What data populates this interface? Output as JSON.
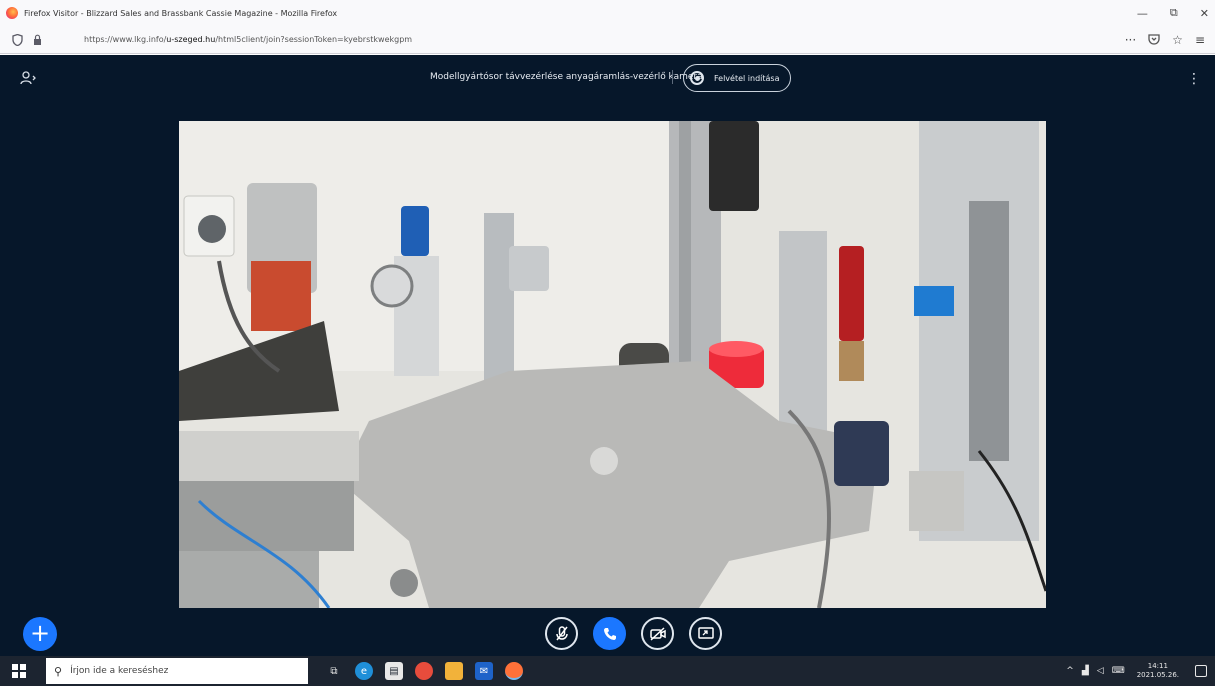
{
  "browser": {
    "tab_title": "Firefox Visitor - Blizzard Sales and Brassbank Cassie Magazine - Mozilla Firefox",
    "url_prefix": "https://www.lkg.info/",
    "url_domain": "u-szeged.hu",
    "url_path": "/html5client/join?sessionToken=kyebrstkwekgpm",
    "window_controls": {
      "minimize": "—",
      "maximize": "⧉",
      "close": "✕"
    },
    "toolbar_icons": [
      "more-icon",
      "pocket-icon",
      "bookmark-star-icon",
      "menu-icon"
    ]
  },
  "meeting": {
    "title": "Modellgyártósor távvezérlése anyagáramlás-vezérlő kamera",
    "recording_label": "Felvétel indítása",
    "video_alt": "Live camera feed of an automated pneumatic production-line module",
    "controls": [
      {
        "name": "mute-button",
        "icon": "microphone-off-icon",
        "glyph": "🎤",
        "active": false
      },
      {
        "name": "leave-audio-button",
        "icon": "phone-icon",
        "glyph": "✆",
        "active": true
      },
      {
        "name": "camera-button",
        "icon": "camera-off-icon",
        "glyph": "📷",
        "active": false
      },
      {
        "name": "screen-share-button",
        "icon": "screen-share-icon",
        "glyph": "🖵",
        "active": false
      }
    ],
    "fab_label": "+"
  },
  "taskbar": {
    "search_placeholder": "Írjon ide a kereséshez",
    "apps": [
      {
        "name": "task-view-icon",
        "glyph": "⧉",
        "color": "#1c2430",
        "running": false
      },
      {
        "name": "edge-icon",
        "glyph": "e",
        "color": "#1f8fd8",
        "running": false
      },
      {
        "name": "store-icon",
        "glyph": "🛍",
        "color": "#e8e8e8",
        "running": false
      },
      {
        "name": "chrome-icon",
        "glyph": "●",
        "color": "#e74c3c",
        "running": false
      },
      {
        "name": "file-explorer-icon",
        "glyph": "📁",
        "color": "#f2b23a",
        "running": false
      },
      {
        "name": "outlook-icon",
        "glyph": "✉",
        "color": "#1e63c9",
        "running": false
      },
      {
        "name": "firefox-icon",
        "glyph": "🦊",
        "color": "#ff7139",
        "running": true
      }
    ],
    "time": "14:11",
    "date": "2021.05.26."
  }
}
